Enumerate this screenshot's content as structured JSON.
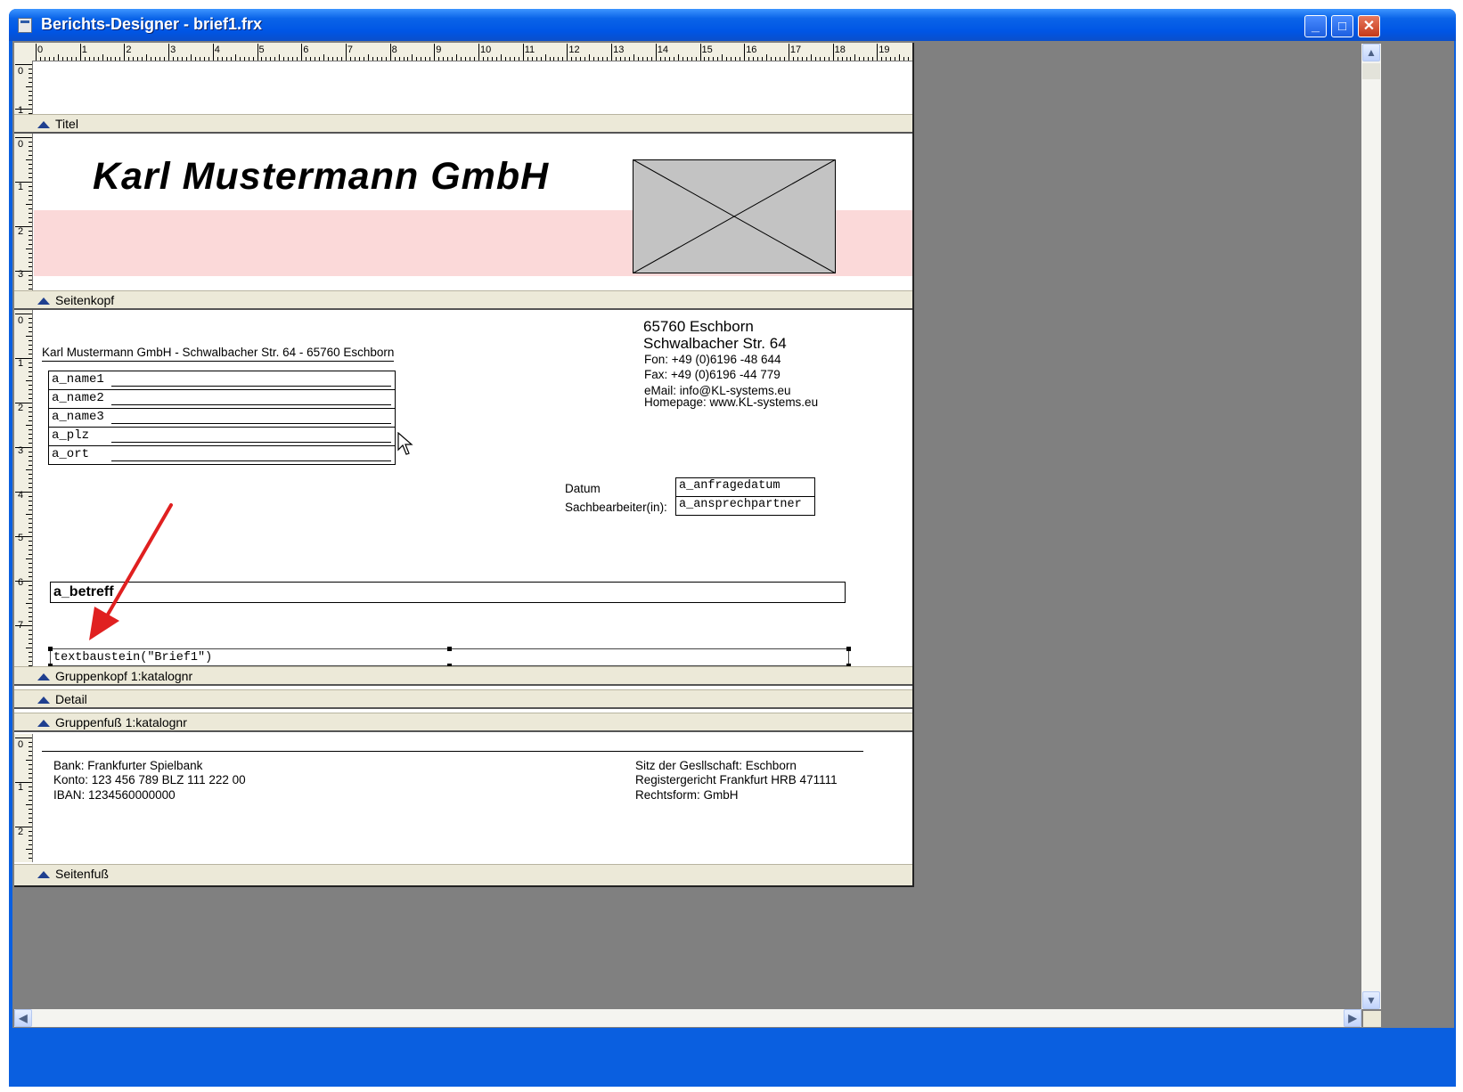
{
  "window": {
    "title": "Berichts-Designer - brief1.frx",
    "minimize": "_",
    "maximize": "□",
    "close": "✕"
  },
  "ruler": {
    "marks": [
      "0",
      "1",
      "2",
      "3",
      "4",
      "5",
      "6",
      "7",
      "8",
      "9",
      "10",
      "11",
      "12",
      "13",
      "14",
      "15",
      "16",
      "17",
      "18",
      "19"
    ]
  },
  "vruler": {
    "title": [
      "0",
      "1"
    ],
    "page_header": [
      "0",
      "1",
      "2",
      "3"
    ],
    "group_header": [
      "0",
      "1",
      "2",
      "3",
      "4",
      "5",
      "6",
      "7"
    ],
    "footer": [
      "0",
      "1",
      "2"
    ]
  },
  "bands": {
    "title": "Titel",
    "page_header": "Seitenkopf",
    "group_header": "Gruppenkopf 1:katalognr",
    "detail": "Detail",
    "group_footer": "Gruppenfuß 1:katalognr",
    "page_footer": "Seitenfuß"
  },
  "header": {
    "company": "Karl Mustermann GmbH"
  },
  "address": {
    "sender_line": "Karl Mustermann GmbH - Schwalbacher Str. 64 - 65760 Eschborn",
    "fields": [
      "a_name1",
      "a_name2",
      "a_name3",
      "a_plz",
      "a_ort"
    ]
  },
  "contact": {
    "city": "65760 Eschborn",
    "street": "Schwalbacher Str. 64",
    "phone": "Fon: +49 (0)6196 -48 644",
    "fax": "Fax: +49 (0)6196 -44 779",
    "email": "eMail:  info@KL-systems.eu",
    "homepage": "Homepage: www.KL-systems.eu"
  },
  "meta": {
    "date_label": "Datum",
    "date_field": "a_anfragedatum",
    "clerk_label": "Sachbearbeiter(in):",
    "clerk_field": "a_ansprechpartner"
  },
  "body": {
    "subject": "a_betreff",
    "text": "textbaustein(\"Brief1\")"
  },
  "footer": {
    "bank": "Bank:  Frankfurter Spielbank",
    "account": "Konto: 123 456 789   BLZ  111 222 00",
    "iban": "IBAN:  1234560000000",
    "seat": "Sitz der Gesllschaft: Eschborn",
    "court": "Registergericht Frankfurt HRB 471111",
    "legal": "Rechtsform: GmbH"
  },
  "colors": {
    "brand_stripe": "#fbd9d9",
    "annotation_arrow": "#e02020",
    "band": "#ece9d8"
  }
}
